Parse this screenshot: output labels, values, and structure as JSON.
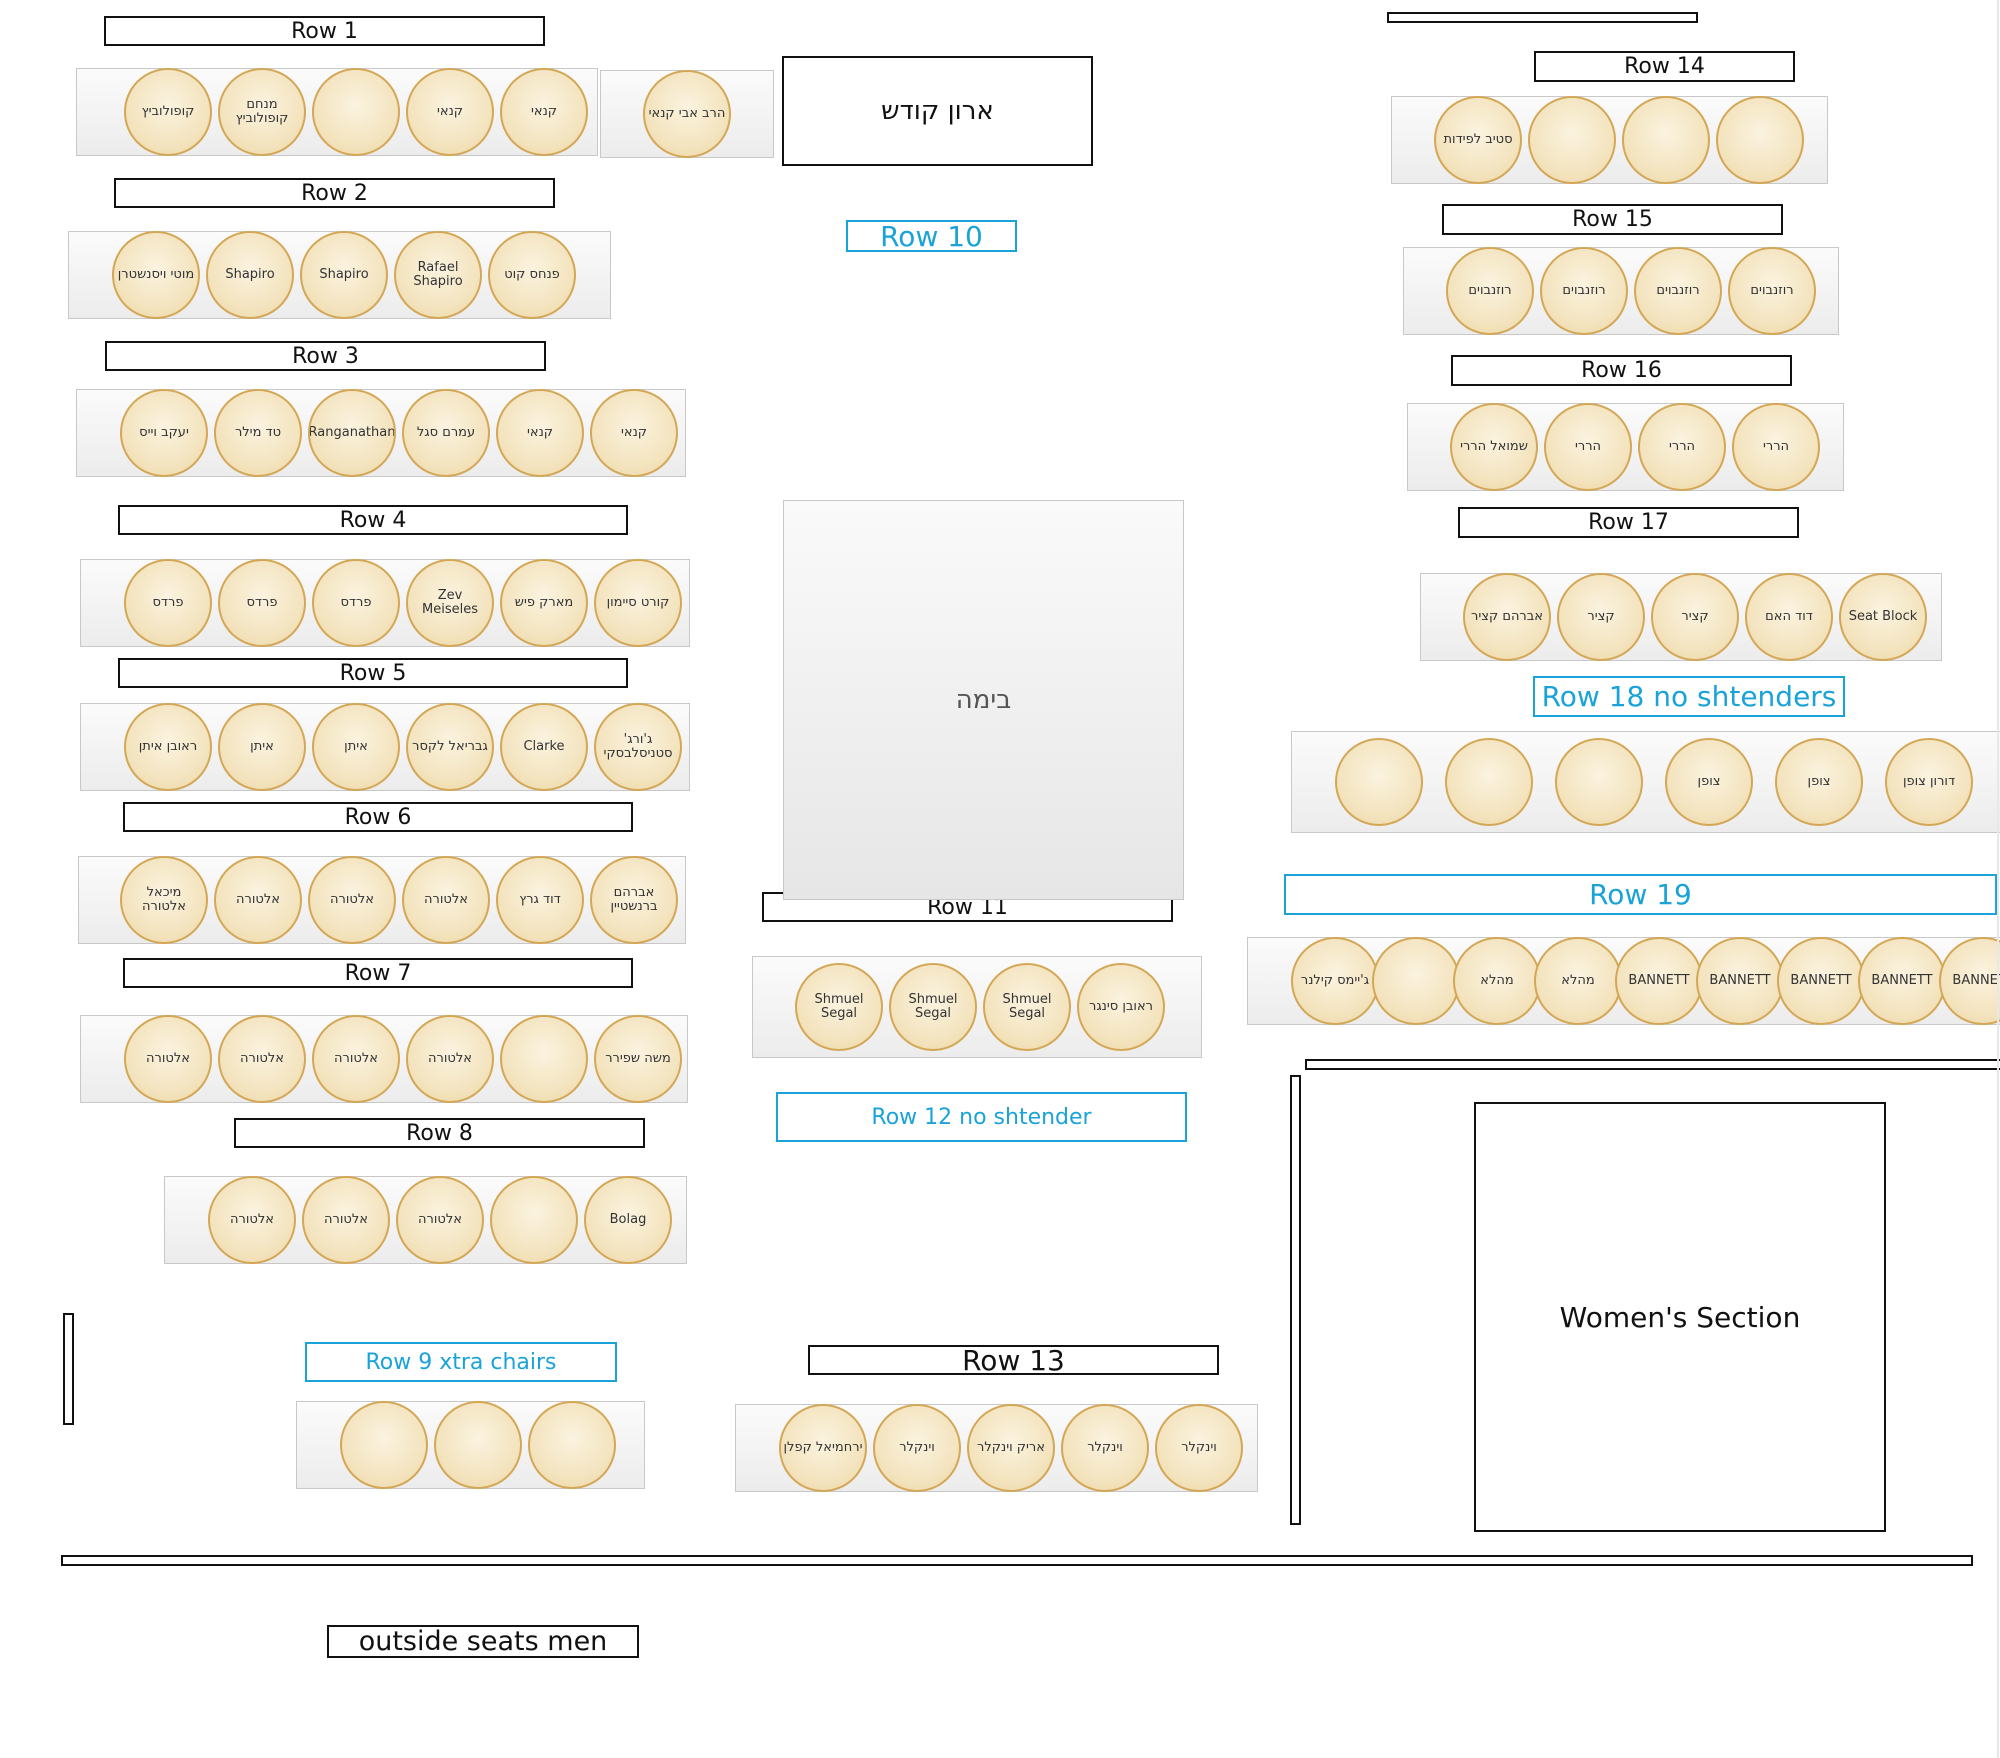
{
  "rows": [
    {
      "label": "Row 1",
      "seats": [
        "קופולוביץ",
        "מנחם קופולוביץ",
        "",
        "קנאי",
        "קנאי"
      ]
    },
    {
      "label": "Row 1",
      "seats": [
        "הרב אבי קנאי"
      ]
    },
    {
      "label": "Row 2",
      "seats": [
        "מוטי ויסנשטרן",
        "Shapiro",
        "Shapiro",
        "Rafael Shapiro",
        "פנחס קוט"
      ]
    },
    {
      "label": "Row 3",
      "seats": [
        "יעקב וייס",
        "טד מילר",
        "Ranganathan",
        "עמרם סגל",
        "קנאי",
        "קנאי"
      ]
    },
    {
      "label": "Row 4",
      "seats": [
        "פרדס",
        "פרדס",
        "פרדס",
        "Zev Meiseles",
        "מארק פיש",
        "קורט סיימון"
      ]
    },
    {
      "label": "Row 5",
      "seats": [
        "ראובן איתן",
        "איתן",
        "איתן",
        "גבריאל לקסר",
        "Clarke",
        "ג'ורג' סטניסלבסקי"
      ]
    },
    {
      "label": "Row 6",
      "seats": [
        "מיכאל אלטורה",
        "אלטורה",
        "אלטורה",
        "אלטורה",
        "דוד גרץ",
        "אברהם ברנשטיין"
      ]
    },
    {
      "label": "Row 7",
      "seats": [
        "אלטורה",
        "אלטורה",
        "אלטורה",
        "אלטורה",
        "",
        "משה שפירר"
      ]
    },
    {
      "label": "Row 8",
      "seats": [
        "אלטורה",
        "אלטורה",
        "אלטורה",
        "",
        "Bolag"
      ]
    },
    {
      "label": "Row 9  xtra chairs",
      "seats": [
        "",
        "",
        ""
      ]
    },
    {
      "label": "Row 10",
      "seats": []
    },
    {
      "label": "Row 11",
      "seats": [
        "Shmuel Segal",
        "Shmuel Segal",
        "Shmuel Segal",
        "ראובן סינגר"
      ]
    },
    {
      "label": "Row 12 no shtender",
      "seats": []
    },
    {
      "label": "Row 13",
      "seats": [
        "ירחמיאל קפלן",
        "וינקלר",
        "אריק וינקלר",
        "וינקלר",
        "וינקלר"
      ]
    },
    {
      "label": "Row 14",
      "seats": [
        "סטיב לפידות",
        "",
        "",
        ""
      ]
    },
    {
      "label": "Row 15",
      "seats": [
        "רוזנבוים",
        "רוזנבוים",
        "רוזנבוים",
        "רוזנבוים"
      ]
    },
    {
      "label": "Row 16",
      "seats": [
        "שמואל הררי",
        "הררי",
        "הררי",
        "הררי"
      ]
    },
    {
      "label": "Row 17",
      "seats": [
        "אברהם קציר",
        "קציר",
        "קציר",
        "דוד האם",
        "Seat Block"
      ]
    },
    {
      "label": "Row 18 no shtenders",
      "seats": [
        "",
        "",
        "",
        "צופן",
        "צופן",
        "דורון צופן"
      ]
    },
    {
      "label": "Row 19",
      "seats": [
        "ג'יימס קילנר",
        "",
        "מהלא",
        "מהלא",
        "BANNETT",
        "BANNETT",
        "BANNETT",
        "BANNETT",
        "BANNETT"
      ]
    }
  ],
  "ark": "ארון קודש",
  "bimah": "בימה",
  "womens_section": "Women's Section",
  "outside_seats": "outside seats men"
}
